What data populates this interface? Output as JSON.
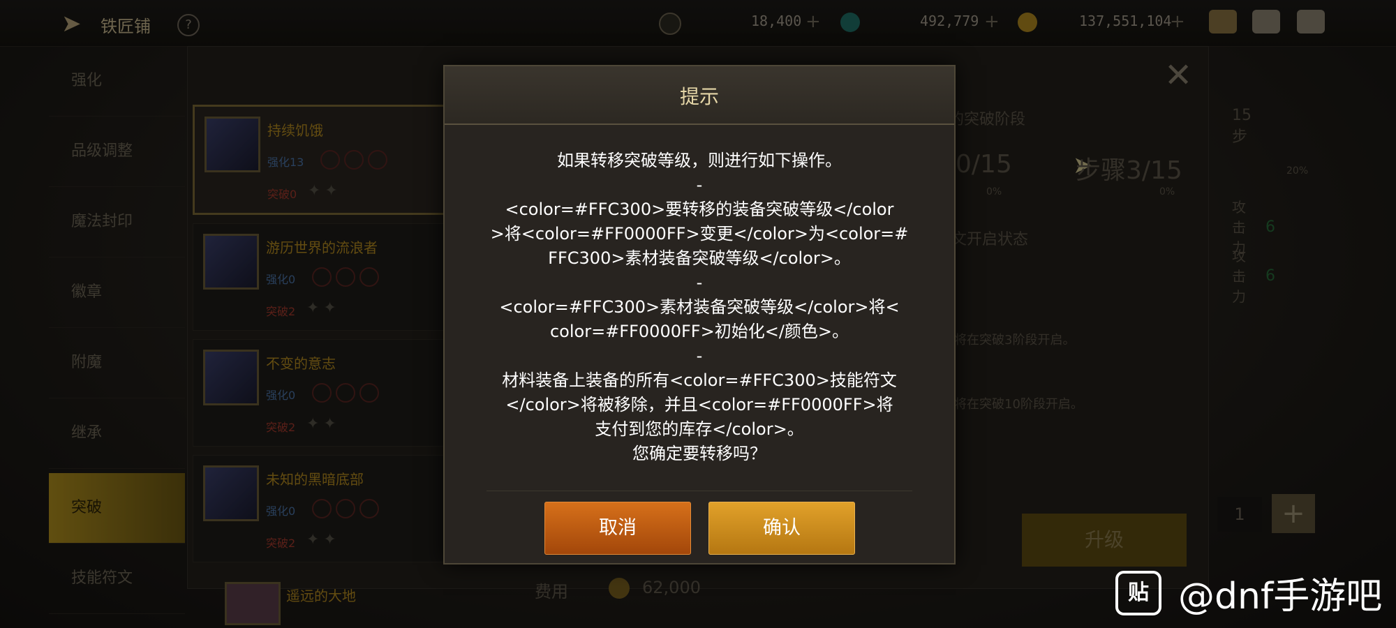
{
  "topbar": {
    "title": "铁匠铺",
    "help": "?",
    "currency1": "18,400",
    "currency2": "492,779",
    "currency3": "137,551,104",
    "plus": "+"
  },
  "nav": {
    "items": [
      {
        "label": "强化"
      },
      {
        "label": "品级调整"
      },
      {
        "label": "魔法封印"
      },
      {
        "label": "徽章"
      },
      {
        "label": "附魔"
      },
      {
        "label": "继承"
      },
      {
        "label": "突破"
      },
      {
        "label": "技能符文"
      }
    ],
    "active_index": 6
  },
  "panel": {
    "steps_left": "0/15",
    "steps_right": "步骤3/15",
    "step_hint": "15步",
    "pct_a": "0%",
    "pct_b": "0%",
    "pct_c": "20%",
    "stage_label": "的突破阶段",
    "rune_label": "文开启状态",
    "rune_note1": "将在突破3阶段开启。",
    "rune_note2": "将在突破10阶段开启。",
    "attack_a": "攻击力",
    "attack_b": "攻击力",
    "val_a": "6",
    "val_b": "6",
    "qty": "1",
    "qty_plus": "+",
    "upgrade": "升级",
    "cost_label": "费用",
    "cost_value": "62,000"
  },
  "cards": [
    {
      "name": "持续饥饿",
      "level": "强化13",
      "breakthrough": "突破0"
    },
    {
      "name": "游历世界的流浪者",
      "level": "强化0",
      "breakthrough": "突破2"
    },
    {
      "name": "不变的意志",
      "level": "强化0",
      "breakthrough": "突破2"
    },
    {
      "name": "未知的黑暗底部",
      "level": "强化0",
      "breakthrough": "突破2"
    },
    {
      "name": "遥远的大地",
      "level": "",
      "breakthrough": ""
    }
  ],
  "dialog": {
    "title": "提示",
    "lines": [
      "如果转移突破等级，则进行如下操作。",
      "-",
      "<color=#FFC300>要转移的装备突破等级</color",
      ">将<color=#FF0000FF>变更</color>为<color=#",
      "FFC300>素材装备突破等级</color>。",
      "-",
      "<color=#FFC300>素材装备突破等级</color>将<",
      "color=#FF0000FF>初始化</颜色>。",
      "-",
      "材料装备上装备的所有<color=#FFC300>技能符文",
      "</color>将被移除，并且<color=#FF0000FF>将",
      "支付到您的库存</color>。",
      "您确定要转移吗？"
    ],
    "cancel": "取消",
    "confirm": "确认"
  },
  "watermark": {
    "icon_text": "贴",
    "text": "@dnf手游吧"
  },
  "colors": {
    "cancel_button": "#c45f12",
    "confirm_button": "#d08f1f",
    "active_nav": "#b08f1e"
  }
}
